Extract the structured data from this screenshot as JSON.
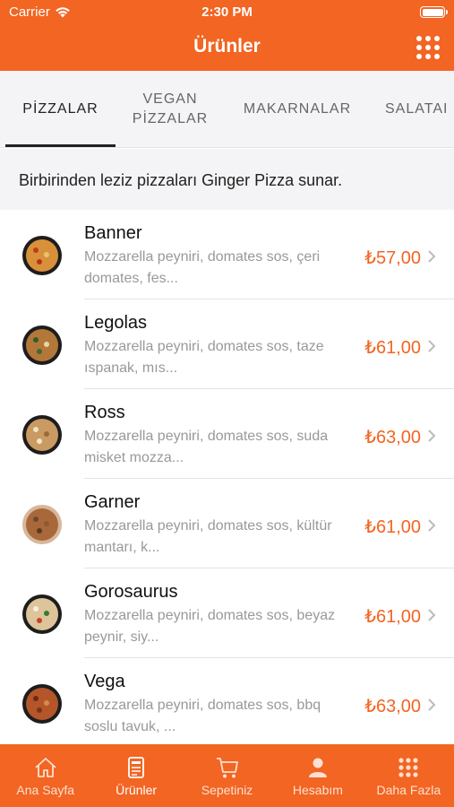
{
  "status": {
    "carrier": "Carrier",
    "time": "2:30 PM"
  },
  "header": {
    "title": "Ürünler"
  },
  "tabs": [
    {
      "label": "PİZZALAR",
      "active": true
    },
    {
      "label": "VEGAN\nPİZZALAR",
      "active": false
    },
    {
      "label": "MAKARNALAR",
      "active": false
    },
    {
      "label": "SALATAI",
      "active": false
    }
  ],
  "intro": "Birbirinden leziz pizzaları Ginger Pizza sunar.",
  "products": [
    {
      "name": "Banner",
      "desc": "Mozzarella peyniri, domates sos, çeri domates, fes...",
      "price": "₺57,00"
    },
    {
      "name": "Legolas",
      "desc": "Mozzarella peyniri, domates sos, taze ıspanak, mıs...",
      "price": "₺61,00"
    },
    {
      "name": "Ross",
      "desc": "Mozzarella peyniri, domates sos, suda misket mozza...",
      "price": "₺63,00"
    },
    {
      "name": "Garner",
      "desc": "Mozzarella peyniri, domates sos, kültür mantarı, k...",
      "price": "₺61,00"
    },
    {
      "name": "Gorosaurus",
      "desc": "Mozzarella peyniri, domates sos, beyaz peynir, siy...",
      "price": "₺61,00"
    },
    {
      "name": "Vega",
      "desc": "Mozzarella peyniri, domates sos, bbq soslu tavuk, ...",
      "price": "₺63,00"
    }
  ],
  "tabbar": [
    {
      "label": "Ana Sayfa",
      "icon": "home-icon"
    },
    {
      "label": "Ürünler",
      "icon": "menu-icon",
      "active": true
    },
    {
      "label": "Sepetiniz",
      "icon": "cart-icon"
    },
    {
      "label": "Hesabım",
      "icon": "user-icon"
    },
    {
      "label": "Daha Fazla",
      "icon": "more-icon"
    }
  ],
  "colors": {
    "accent": "#f26522",
    "price": "#f26522",
    "muted": "#999999"
  }
}
